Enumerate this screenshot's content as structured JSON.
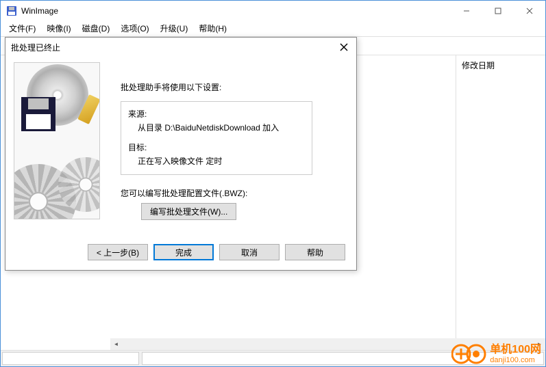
{
  "window": {
    "title": "WinImage"
  },
  "menu": {
    "file": "文件(F)",
    "image": "映像(I)",
    "disk": "磁盘(D)",
    "options": "选项(O)",
    "upgrade": "升级(U)",
    "help": "帮助(H)"
  },
  "columns": {
    "modified": "修改日期"
  },
  "dialog": {
    "title": "批处理已终止",
    "intro": "批处理助手将使用以下设置:",
    "source_label": "来源:",
    "source_value": "从目录 D:\\BaiduNetdiskDownload 加入",
    "target_label": "目标:",
    "target_value": "正在写入映像文件 定时",
    "config_text": "您可以编写批处理配置文件(.BWZ):",
    "config_button": "编写批处理文件(W)...",
    "back": "< 上一步(B)",
    "finish": "完成",
    "cancel": "取消",
    "help": "帮助"
  },
  "watermark": {
    "text": "单机100网",
    "url": "danji100.com"
  }
}
